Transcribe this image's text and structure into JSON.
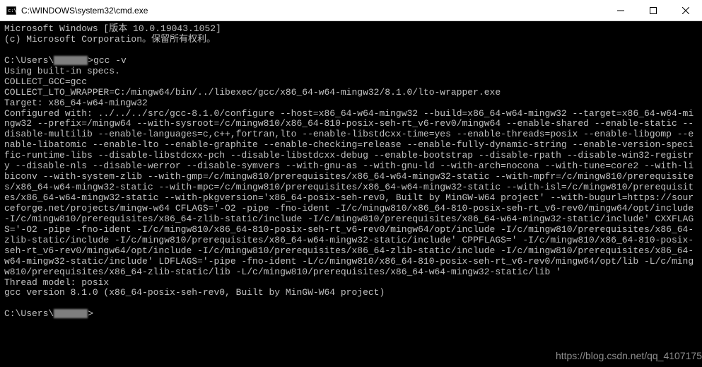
{
  "window": {
    "title": "C:\\WINDOWS\\system32\\cmd.exe"
  },
  "prompt1_prefix": "C:\\Users\\",
  "prompt1_suffix": ">gcc -v",
  "lines": {
    "l1": "Microsoft Windows [版本 10.0.19043.1052]",
    "l2": "(c) Microsoft Corporation。保留所有权利。",
    "l3": "Using built-in specs.",
    "l4": "COLLECT_GCC=gcc",
    "l5": "COLLECT_LTO_WRAPPER=C:/mingw64/bin/../libexec/gcc/x86_64-w64-mingw32/8.1.0/lto-wrapper.exe",
    "l6": "Target: x86_64-w64-mingw32",
    "l7": "Configured with: ../../../src/gcc-8.1.0/configure --host=x86_64-w64-mingw32 --build=x86_64-w64-mingw32 --target=x86_64-w64-mingw32 --prefix=/mingw64 --with-sysroot=/c/mingw810/x86_64-810-posix-seh-rt_v6-rev0/mingw64 --enable-shared --enable-static --disable-multilib --enable-languages=c,c++,fortran,lto --enable-libstdcxx-time=yes --enable-threads=posix --enable-libgomp --enable-libatomic --enable-lto --enable-graphite --enable-checking=release --enable-fully-dynamic-string --enable-version-specific-runtime-libs --disable-libstdcxx-pch --disable-libstdcxx-debug --enable-bootstrap --disable-rpath --disable-win32-registry --disable-nls --disable-werror --disable-symvers --with-gnu-as --with-gnu-ld --with-arch=nocona --with-tune=core2 --with-libiconv --with-system-zlib --with-gmp=/c/mingw810/prerequisites/x86_64-w64-mingw32-static --with-mpfr=/c/mingw810/prerequisites/x86_64-w64-mingw32-static --with-mpc=/c/mingw810/prerequisites/x86_64-w64-mingw32-static --with-isl=/c/mingw810/prerequisites/x86_64-w64-mingw32-static --with-pkgversion='x86_64-posix-seh-rev0, Built by MinGW-W64 project' --with-bugurl=https://sourceforge.net/projects/mingw-w64 CFLAGS='-O2 -pipe -fno-ident -I/c/mingw810/x86_64-810-posix-seh-rt_v6-rev0/mingw64/opt/include -I/c/mingw810/prerequisites/x86_64-zlib-static/include -I/c/mingw810/prerequisites/x86_64-w64-mingw32-static/include' CXXFLAGS='-O2 -pipe -fno-ident -I/c/mingw810/x86_64-810-posix-seh-rt_v6-rev0/mingw64/opt/include -I/c/mingw810/prerequisites/x86_64-zlib-static/include -I/c/mingw810/prerequisites/x86_64-w64-mingw32-static/include' CPPFLAGS=' -I/c/mingw810/x86_64-810-posix-seh-rt_v6-rev0/mingw64/opt/include -I/c/mingw810/prerequisites/x86_64-zlib-static/include -I/c/mingw810/prerequisites/x86_64-w64-mingw32-static/include' LDFLAGS='-pipe -fno-ident -L/c/mingw810/x86_64-810-posix-seh-rt_v6-rev0/mingw64/opt/lib -L/c/mingw810/prerequisites/x86_64-zlib-static/lib -L/c/mingw810/prerequisites/x86_64-w64-mingw32-static/lib '",
    "l8": "Thread model: posix",
    "l9": "gcc version 8.1.0 (x86_64-posix-seh-rev0, Built by MinGW-W64 project)",
    "prompt2_prefix": "C:\\Users\\",
    "prompt2_suffix": ">"
  },
  "watermark": "https://blog.csdn.net/qq_4107175"
}
